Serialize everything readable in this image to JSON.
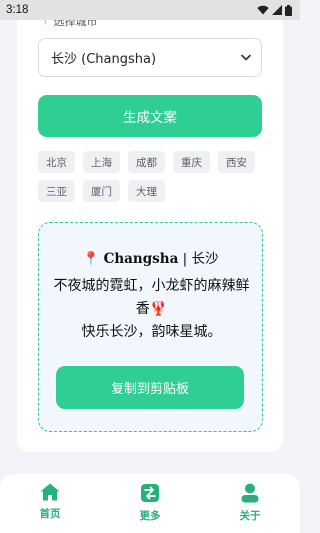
{
  "status_bar": {
    "time": "3:18",
    "icons": [
      "wifi-icon",
      "signal-icon",
      "battery-icon"
    ]
  },
  "form": {
    "city_label": "选择城市",
    "city_label_icon": "location-pin-icon",
    "selected_city": "长沙 (Changsha)",
    "generate_label": "生成文案"
  },
  "quick_cities": [
    "北京",
    "上海",
    "成都",
    "重庆",
    "西安",
    "三亚",
    "厦门",
    "大理"
  ],
  "result": {
    "pin_icon": "📍",
    "title_en": "Changsha",
    "title_separator": " | ",
    "title_cn": "长沙",
    "line1": "不夜城的霓虹，小龙虾的麻辣鲜香🦞",
    "line2": "快乐长沙，韵味星城。",
    "copy_label": "复制到剪贴板"
  },
  "nav": {
    "items": [
      {
        "label": "首页",
        "icon": "home-icon"
      },
      {
        "label": "更多",
        "icon": "swap-icon"
      },
      {
        "label": "关于",
        "icon": "user-icon"
      }
    ]
  },
  "colors": {
    "accent": "#2fce92",
    "nav_accent": "#27b07c",
    "background": "#f2f3f8",
    "result_background": "#f2f6fd"
  }
}
